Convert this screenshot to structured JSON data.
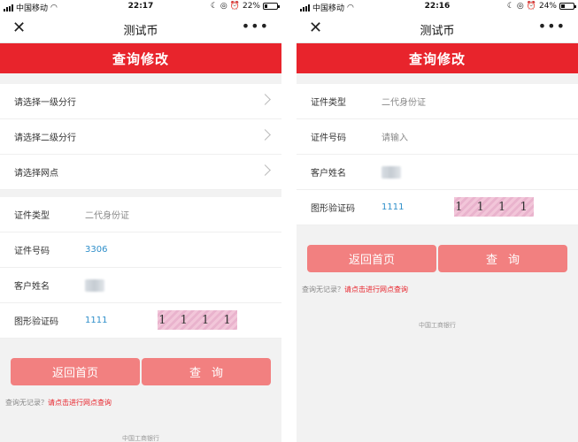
{
  "screens": [
    {
      "status": {
        "carrier": "中国移动",
        "time": "22:17",
        "battery": "22%",
        "battery_level": 0.22
      },
      "app": {
        "title": "测试币"
      },
      "banner": "查询修改",
      "branch_rows": [
        {
          "label": "请选择一级分行"
        },
        {
          "label": "请选择二级分行"
        },
        {
          "label": "请选择网点"
        }
      ],
      "form": {
        "id_type": {
          "label": "证件类型",
          "value": "二代身份证"
        },
        "id_number": {
          "label": "证件号码",
          "value": "3306"
        },
        "customer_name": {
          "label": "客户姓名"
        },
        "captcha": {
          "label": "图形验证码",
          "value": "1111",
          "image_text": "1 1 1 1"
        }
      },
      "buttons": {
        "back": "返回首页",
        "query": "查询"
      },
      "hint": {
        "text": "查询无记录？",
        "link": "请点击进行网点查询"
      },
      "footer": "中国工商银行"
    },
    {
      "status": {
        "carrier": "中国移动",
        "time": "22:16",
        "battery": "24%",
        "battery_level": 0.24
      },
      "app": {
        "title": "测试币"
      },
      "banner": "查询修改",
      "form": {
        "id_type": {
          "label": "证件类型",
          "value": "二代身份证"
        },
        "id_number": {
          "label": "证件号码",
          "placeholder": "请输入"
        },
        "customer_name": {
          "label": "客户姓名"
        },
        "captcha": {
          "label": "图形验证码",
          "value": "1111",
          "image_text": "1 1 1 1"
        }
      },
      "buttons": {
        "back": "返回首页",
        "query": "查询"
      },
      "hint": {
        "text": "查询无记录？",
        "link": "请点击进行网点查询"
      },
      "footer": "中国工商银行"
    }
  ],
  "icons": {
    "close": "close-icon",
    "more": "more-icon",
    "chevron": "chevron-right-icon",
    "signal": "signal-icon",
    "wifi": "wifi-icon",
    "battery": "battery-icon"
  },
  "colors": {
    "brand_red": "#e8242c",
    "button_pink": "#f28080",
    "value_blue": "#2f8fca"
  }
}
